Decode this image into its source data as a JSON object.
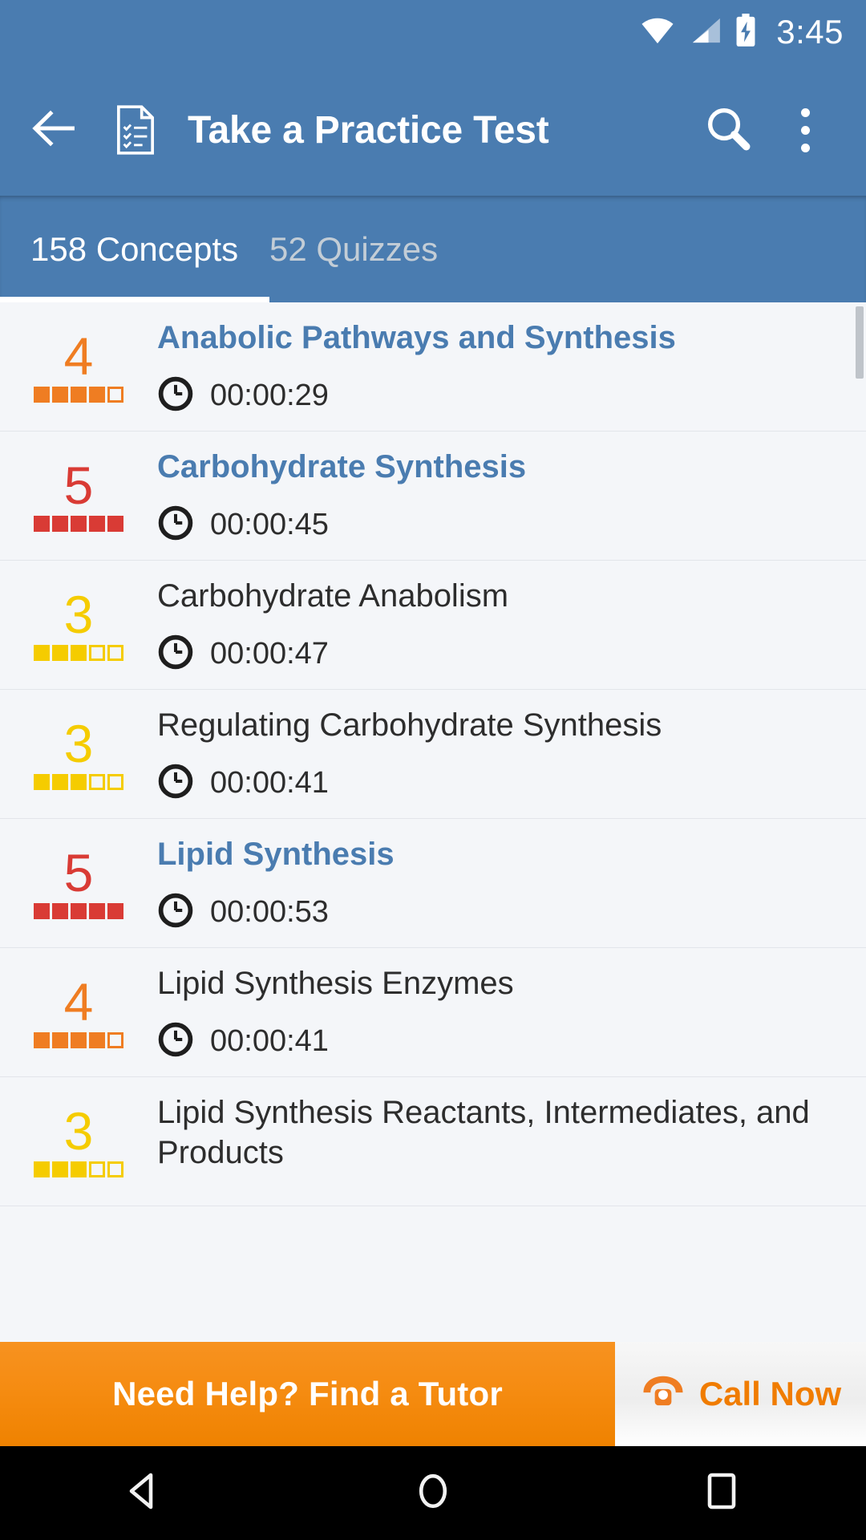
{
  "status_bar": {
    "time": "3:45",
    "icons": [
      "wifi-icon",
      "cellular-signal-icon",
      "battery-charging-icon"
    ]
  },
  "toolbar": {
    "back_icon": "back-arrow-icon",
    "doc_icon": "practice-test-document-icon",
    "title": "Take a Practice Test",
    "search_icon": "search-icon",
    "overflow_icon": "overflow-menu-icon"
  },
  "tabs": [
    {
      "label": "158 Concepts",
      "active": true
    },
    {
      "label": "52 Quizzes",
      "active": false
    }
  ],
  "colors": {
    "primary": "#4a7cb0",
    "orange": "#ef7d22",
    "red": "#d93b35",
    "yellow": "#f5cc00",
    "banner_orange": "#f58b10",
    "link_blue": "#4a7cb0",
    "text_dark": "#2d2d2d"
  },
  "list": {
    "rows": [
      {
        "rating": "4",
        "filled": 4,
        "total": 5,
        "color": "#ef7d22",
        "title": "Anabolic Pathways and Synthesis",
        "visited": true,
        "time": "00:00:29",
        "clock_icon": "clock-icon"
      },
      {
        "rating": "5",
        "filled": 5,
        "total": 5,
        "color": "#d93b35",
        "title": "Carbohydrate Synthesis",
        "visited": true,
        "time": "00:00:45",
        "clock_icon": "clock-icon"
      },
      {
        "rating": "3",
        "filled": 3,
        "total": 5,
        "color": "#f5cc00",
        "title": "Carbohydrate Anabolism",
        "visited": false,
        "time": "00:00:47",
        "clock_icon": "clock-icon"
      },
      {
        "rating": "3",
        "filled": 3,
        "total": 5,
        "color": "#f5cc00",
        "title": "Regulating Carbohydrate Synthesis",
        "visited": false,
        "time": "00:00:41",
        "clock_icon": "clock-icon"
      },
      {
        "rating": "5",
        "filled": 5,
        "total": 5,
        "color": "#d93b35",
        "title": "Lipid Synthesis",
        "visited": true,
        "time": "00:00:53",
        "clock_icon": "clock-icon"
      },
      {
        "rating": "4",
        "filled": 4,
        "total": 5,
        "color": "#ef7d22",
        "title": "Lipid Synthesis Enzymes",
        "visited": false,
        "time": "00:00:41",
        "clock_icon": "clock-icon"
      },
      {
        "rating": "3",
        "filled": 3,
        "total": 5,
        "color": "#f5cc00",
        "title": "Lipid Synthesis Reactants, Intermediates, and Products",
        "visited": false,
        "time": "",
        "clock_icon": "clock-icon"
      }
    ]
  },
  "banner": {
    "tutor_label": "Need Help? Find a Tutor",
    "phone_icon": "phone-icon",
    "call_label": "Call Now"
  },
  "nav_bar": {
    "back": "android-back-icon",
    "home": "android-home-icon",
    "recents": "android-recents-icon"
  }
}
